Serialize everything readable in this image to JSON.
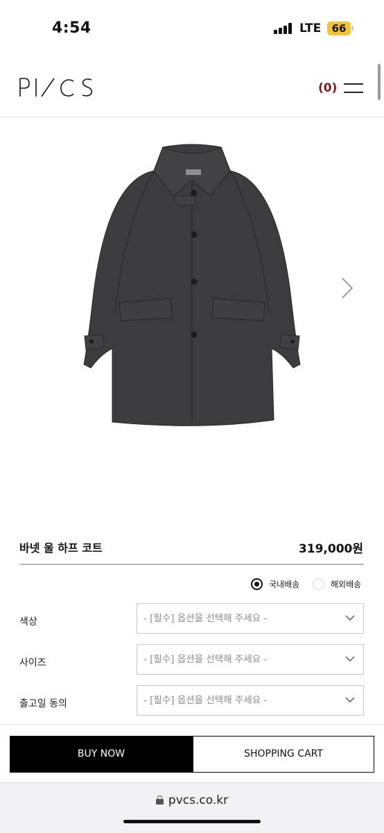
{
  "status_bar": {
    "time": "4:54",
    "carrier": "LTE",
    "battery": "66",
    "battery_color": "#f4c430"
  },
  "header": {
    "logo_alt": "PVCS",
    "cart_count": "(0)",
    "cart_count_color": "#7a1a1a"
  },
  "product": {
    "image_icon": "coat-image",
    "name": "바넷 울 하프 코트",
    "price": "319,000원"
  },
  "shipping": {
    "options": [
      {
        "label": "국내배송",
        "selected": true
      },
      {
        "label": "해외배송",
        "selected": false
      }
    ]
  },
  "options": [
    {
      "label": "색상",
      "placeholder": "- [필수] 옵션을 선택해 주세요 -"
    },
    {
      "label": "사이즈",
      "placeholder": "- [필수] 옵션을 선택해 주세요 -"
    },
    {
      "label": "출고일 동의",
      "placeholder": "- [필수] 옵션을 선택해 주세요 -"
    }
  ],
  "actions": {
    "buy_label": "BUY NOW",
    "cart_label": "SHOPPING CART"
  },
  "browser": {
    "url": "pvcs.co.kr"
  }
}
